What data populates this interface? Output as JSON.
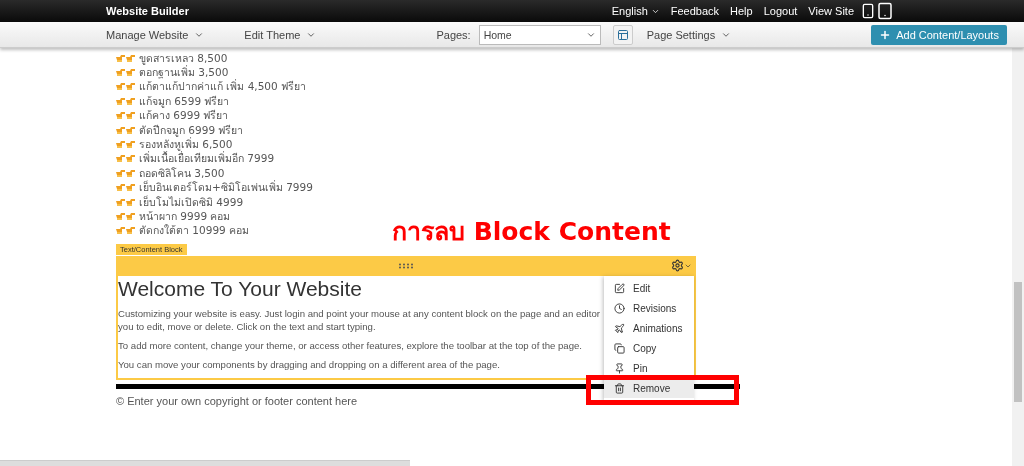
{
  "header": {
    "title": "Website Builder",
    "language": "English",
    "links": [
      "Feedback",
      "Help",
      "Logout",
      "View Site"
    ]
  },
  "toolbar": {
    "menus": [
      "Manage Website",
      "Edit Theme"
    ],
    "pages_label": "Pages:",
    "pages_value": "Home",
    "page_settings": "Page Settings",
    "add_button": "Add Content/Layouts"
  },
  "price_list": [
    "ขูดสารเหลว 8,500",
    "ตอกฐานเพิ่ม 3,500",
    "แก้ตาแก้ปากค่าแก้ เพิ่ม 4,500 ฟรียา",
    "แก้จมูก 6599 ฟรียา",
    "แก้คาง  6999  ฟรียา",
    "ตัดปีกจมูก 6999 ฟรียา",
    "รองหลังหูเพิ่ม 6,500",
    "เพิ่มเนื้อเยื่อเทียมเพิ่มอีก 7999",
    "ถอดซิลิโคน 3,500",
    "เย็บอินเตอร์โดม+ซิมิโอเพ่นเพิ่ม 7999",
    "เย็บโมไม่เปิดซิมิ  4999",
    "หน้าผาก  9999 คอม",
    "ตัดกงใต้ตา 10999  คอม"
  ],
  "annotation": "การลบ Block Content",
  "block": {
    "tab_label": "Text/Content Block",
    "heading": "Welcome To Your Website",
    "paragraphs": [
      [
        "Customizing your website is easy. Just login and point your mouse at any content block on the page and an editor",
        "you to edit, move or delete.  Click on the text and start typing."
      ],
      [
        "To add more content, change your theme, or access other features, explore the toolbar at the top of the page."
      ],
      [
        "You can move your components by dragging and dropping on a different area of the page."
      ]
    ],
    "menu": [
      {
        "kind": "edit",
        "label": "Edit",
        "selected": false
      },
      {
        "kind": "revisions",
        "label": "Revisions",
        "selected": false
      },
      {
        "kind": "animations",
        "label": "Animations",
        "selected": false
      },
      {
        "kind": "copy",
        "label": "Copy",
        "selected": false
      },
      {
        "kind": "pin",
        "label": "Pin",
        "selected": false
      },
      {
        "kind": "remove",
        "label": "Remove",
        "selected": true
      }
    ]
  },
  "footer": "© Enter your own copyright or footer content here"
}
